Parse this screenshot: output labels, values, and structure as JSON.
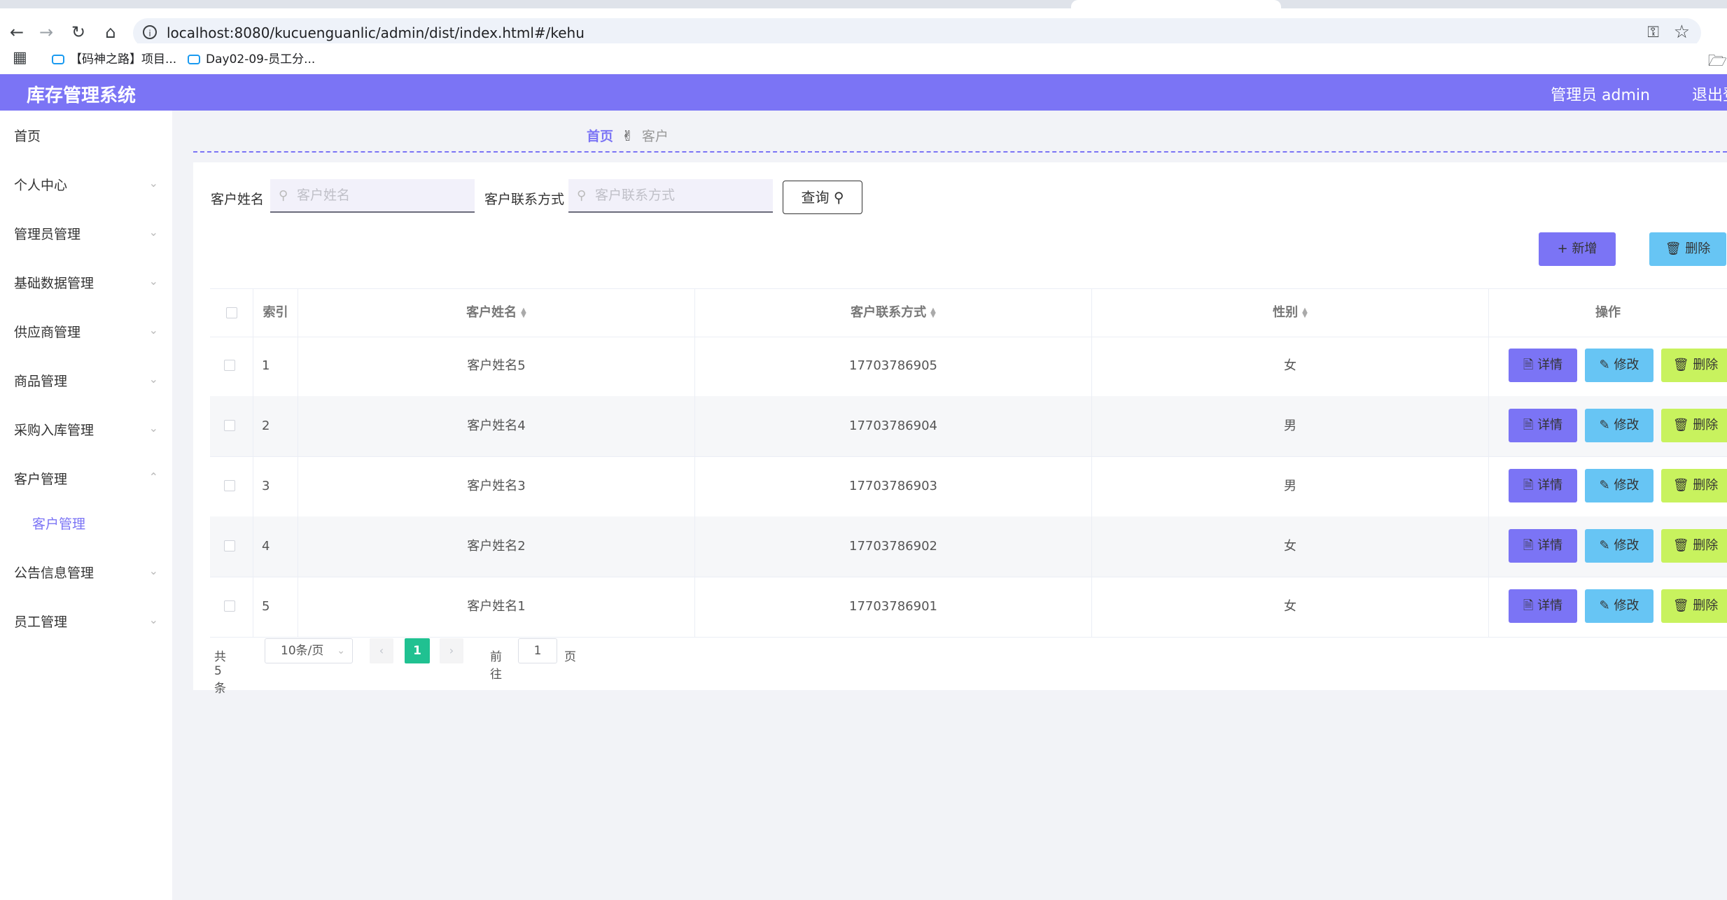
{
  "browser": {
    "url": "localhost:8080/kucuenguanlic/admin/dist/index.html#/kehu",
    "bookmarks": [
      "【码神之路】项目...",
      "Day02-09-员工分..."
    ]
  },
  "app": {
    "title": "库存管理系统",
    "user": "管理员 admin",
    "logout": "退出登录"
  },
  "sidebar": {
    "items": [
      {
        "label": "首页"
      },
      {
        "label": "个人中心"
      },
      {
        "label": "管理员管理"
      },
      {
        "label": "基础数据管理"
      },
      {
        "label": "供应商管理"
      },
      {
        "label": "商品管理"
      },
      {
        "label": "采购入库管理"
      },
      {
        "label": "客户管理"
      },
      {
        "label": "公告信息管理"
      },
      {
        "label": "员工管理"
      }
    ],
    "active_sub": "客户管理"
  },
  "breadcrumb": {
    "home": "首页",
    "current": "客户"
  },
  "search": {
    "name_label": "客户姓名",
    "name_placeholder": "客户姓名",
    "phone_label": "客户联系方式",
    "phone_placeholder": "客户联系方式",
    "query_label": "查询"
  },
  "actions": {
    "add_label": "+ 新增",
    "delete_label": "删除"
  },
  "table": {
    "headers": {
      "index": "索引",
      "name": "客户姓名",
      "phone": "客户联系方式",
      "gender": "性别",
      "ops": "操作"
    },
    "rows": [
      {
        "index": "1",
        "name": "客户姓名5",
        "phone": "17703786905",
        "gender": "女"
      },
      {
        "index": "2",
        "name": "客户姓名4",
        "phone": "17703786904",
        "gender": "男"
      },
      {
        "index": "3",
        "name": "客户姓名3",
        "phone": "17703786903",
        "gender": "男"
      },
      {
        "index": "4",
        "name": "客户姓名2",
        "phone": "17703786902",
        "gender": "女"
      },
      {
        "index": "5",
        "name": "客户姓名1",
        "phone": "17703786901",
        "gender": "女"
      }
    ],
    "row_ops": {
      "detail": "详情",
      "edit": "修改",
      "delete": "删除"
    }
  },
  "pagination": {
    "total": "共 5 条",
    "page_size": "10条/页",
    "current_page": "1",
    "goto_label": "前往",
    "goto_value": "1",
    "page_suffix": "页"
  },
  "colors": {
    "primary": "#7b74f5",
    "info": "#67c5f4",
    "lime": "#c8f25e",
    "pager_active": "#20c191"
  }
}
